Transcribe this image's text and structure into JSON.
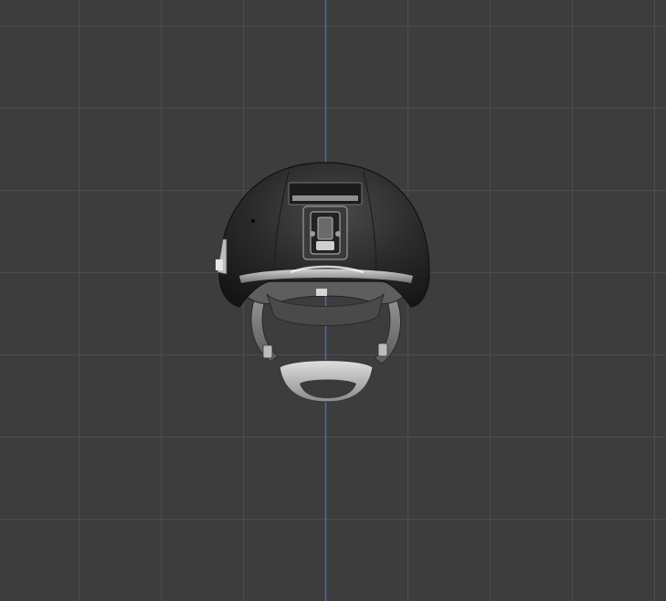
{
  "viewport": {
    "background_color": "#3d3d3d",
    "grid_line_color": "#4e4e4e",
    "axis_color": "#4a6fb5",
    "grid": "on"
  },
  "model": {
    "object": "helmet-icon",
    "shell_color": "#2e2e2e",
    "highlight_color": "#d8d8d8"
  }
}
